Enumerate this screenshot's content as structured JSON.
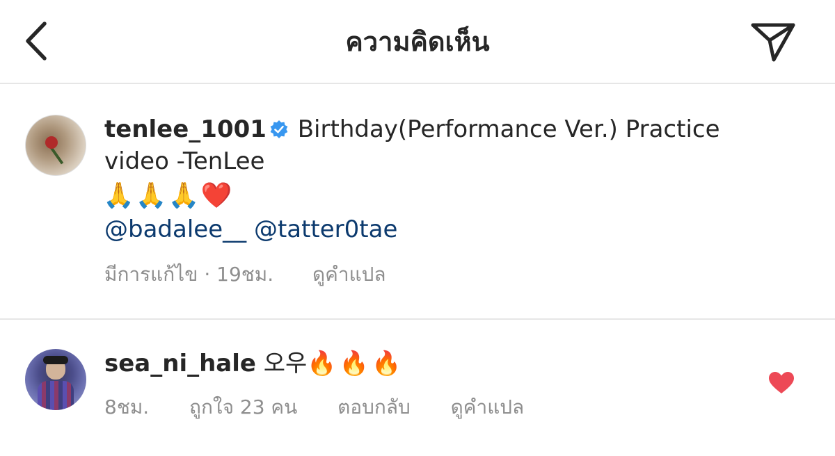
{
  "header": {
    "title": "ความคิดเห็น",
    "back_icon": "chevron-left-icon",
    "share_icon": "paper-plane-icon"
  },
  "caption": {
    "username": "tenlee_1001",
    "verified": true,
    "text_line1": "Birthday(Performance Ver.) Practice",
    "text_line2": "video -TenLee",
    "emojis": [
      "🙏",
      "🙏",
      "🙏",
      "❤️"
    ],
    "mentions": [
      "@badalee__",
      "@tatter0tae"
    ],
    "edited_label": "มีการแก้ไข",
    "separator": "·",
    "time": "19ชม.",
    "translate_label": "ดูคำแปล"
  },
  "comment": {
    "username": "sea_ni_hale",
    "text": "오우",
    "emojis": [
      "🔥",
      "🔥",
      "🔥"
    ],
    "time": "8ชม.",
    "likes_label": "ถูกใจ 23 คน",
    "reply_label": "ตอบกลับ",
    "translate_label": "ดูคำแปล",
    "liked": true
  },
  "colors": {
    "text": "#262626",
    "secondary": "#8e8e8e",
    "link": "#0c3a6e",
    "verified": "#3897f0",
    "heart": "#ed4956",
    "divider": "#e6e6e6"
  }
}
